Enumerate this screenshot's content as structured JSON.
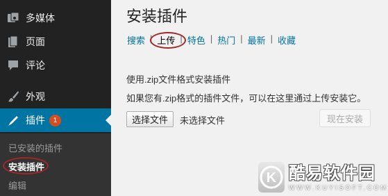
{
  "sidebar": {
    "items": [
      {
        "label": "多媒体",
        "icon": "media-icon"
      },
      {
        "label": "页面",
        "icon": "pages-icon"
      },
      {
        "label": "评论",
        "icon": "comments-icon"
      },
      {
        "label": "外观",
        "icon": "appearance-brush-icon"
      },
      {
        "label": "插件",
        "icon": "plugins-plug-icon",
        "badge": "1",
        "active": true
      }
    ],
    "submenu": [
      {
        "label": "已安装的插件"
      },
      {
        "label": "安装插件",
        "current": true
      },
      {
        "label": "编辑"
      }
    ]
  },
  "main": {
    "title": "安装插件",
    "filters": [
      {
        "label": "搜索"
      },
      {
        "label": "上传",
        "current": true
      },
      {
        "label": "特色"
      },
      {
        "label": "热门"
      },
      {
        "label": "最新"
      },
      {
        "label": "收藏"
      }
    ],
    "separator": "|",
    "upload_hint": "使用.zip文件格式安装插件",
    "upload_desc": "如果您有.zip格式的插件文件，可以在这里通过上传安装它。",
    "choose_file_button": "选择文件",
    "no_file_text": "未选择文件",
    "install_button": "现在安装"
  },
  "watermark": {
    "text_cn": "酷易软件园",
    "text_en": "WWW.KUYISOFT.COM",
    "logo_letter": "K"
  },
  "colors": {
    "sidebar_bg": "#222222",
    "active_bg": "#0074a2",
    "link": "#0074a2",
    "highlight_ellipse": "#a3262a",
    "badge": "#d54e21"
  }
}
